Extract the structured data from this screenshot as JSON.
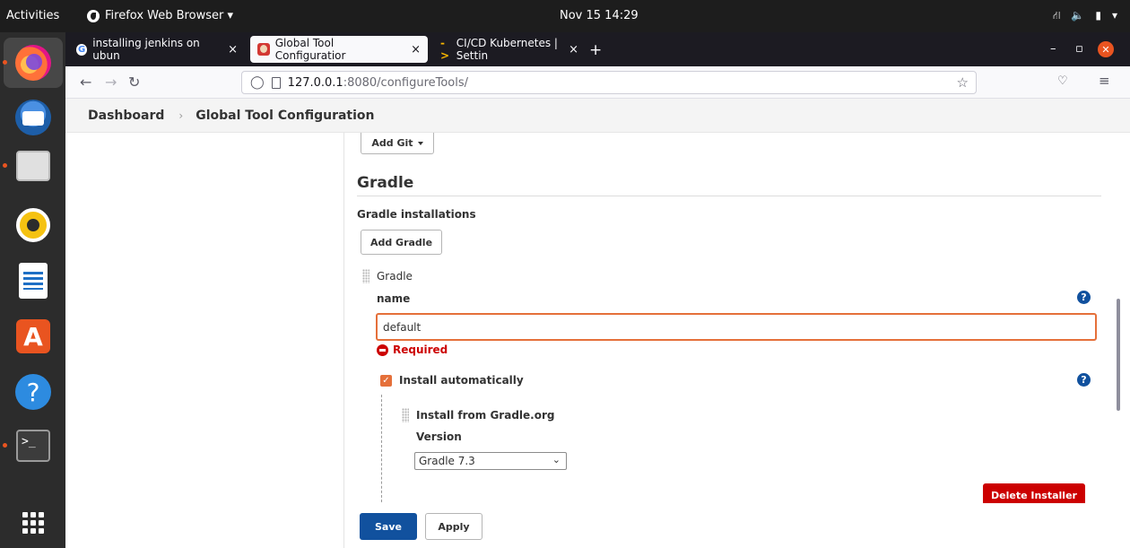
{
  "topbar": {
    "activities": "Activities",
    "app_name": "Firefox Web Browser ▾",
    "clock": "Nov 15  14:29",
    "tray_icons": [
      "network-icon",
      "volume-icon",
      "battery-icon",
      "menu-caret-icon"
    ]
  },
  "dock": {
    "items": [
      "firefox-icon",
      "thunderbird-icon",
      "files-icon",
      "rhythmbox-icon",
      "writer-icon",
      "app-center-icon",
      "help-icon",
      "terminal-icon",
      "show-apps-icon"
    ]
  },
  "browser": {
    "tabs": [
      {
        "label": "installing jenkins on ubun",
        "icon": "google-icon"
      },
      {
        "label": "Global Tool Configuratior",
        "icon": "jenkins-icon",
        "active": true
      },
      {
        "label": "CI/CD Kubernetes | Settin",
        "icon": "gitlab-arrow-icon"
      }
    ],
    "new_tab": "+",
    "close_glyph": "×",
    "url_host": "127.0.0.1",
    "url_path": ":8080/configureTools/"
  },
  "breadcrumb": {
    "dashboard": "Dashboard",
    "separator": "›",
    "current": "Global Tool Configuration"
  },
  "page": {
    "add_git_label": "Add Git",
    "gradle_heading": "Gradle",
    "gradle_installations_label": "Gradle installations",
    "add_gradle_label": "Add Gradle",
    "gradle_item_label": "Gradle",
    "name_label": "name",
    "name_value": "default",
    "required_message": "Required",
    "install_automatically_label": "Install automatically",
    "installer_title": "Install from Gradle.org",
    "version_label": "Version",
    "version_selected": "Gradle 7.3",
    "delete_installer_label": "Delete Installer",
    "save_label": "Save",
    "apply_label": "Apply",
    "help_glyph": "?"
  }
}
